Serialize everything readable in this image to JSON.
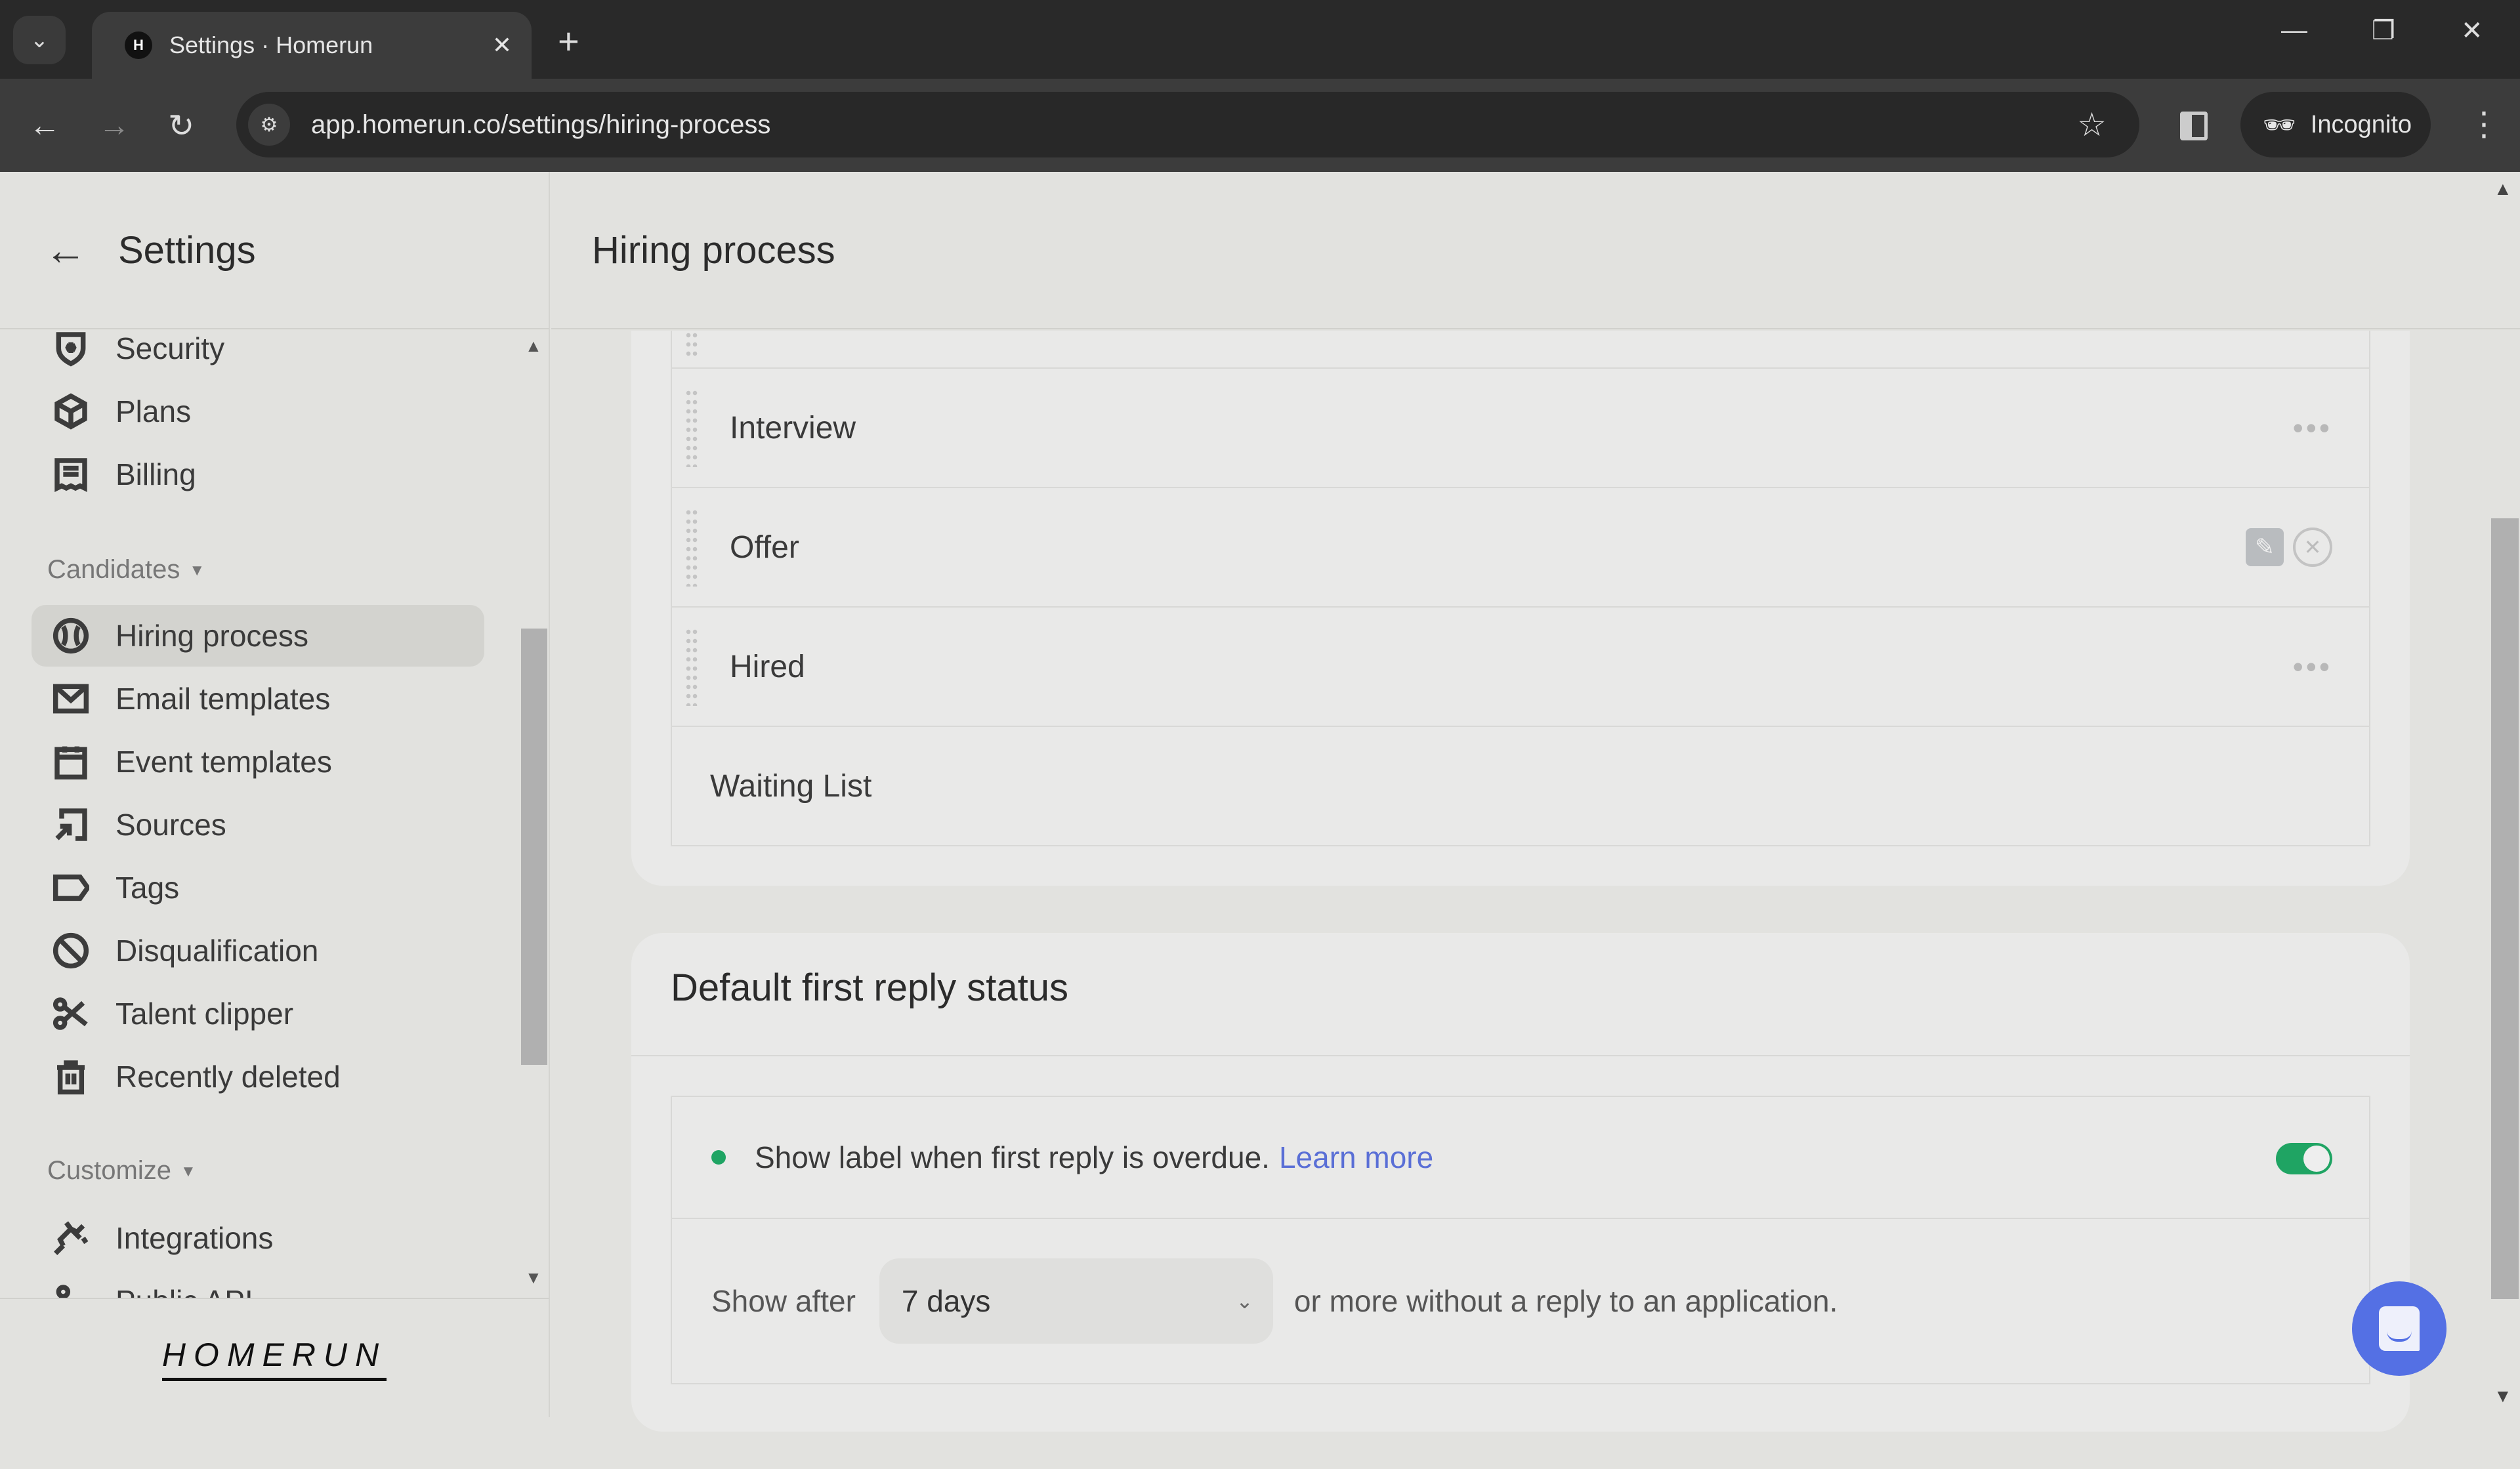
{
  "browser": {
    "tab_title": "Settings · Homerun",
    "url": "app.homerun.co/settings/hiring-process",
    "incognito_label": "Incognito"
  },
  "sidebar": {
    "title": "Settings",
    "items_top": [
      {
        "label": "Security",
        "icon": "shield-star-icon"
      },
      {
        "label": "Plans",
        "icon": "box-icon"
      },
      {
        "label": "Billing",
        "icon": "receipt-icon"
      }
    ],
    "sections": [
      {
        "label": "Candidates",
        "items": [
          {
            "label": "Hiring process",
            "icon": "baseball-icon",
            "active": true
          },
          {
            "label": "Email templates",
            "icon": "envelope-icon"
          },
          {
            "label": "Event templates",
            "icon": "calendar-icon"
          },
          {
            "label": "Sources",
            "icon": "sources-arrow-icon"
          },
          {
            "label": "Tags",
            "icon": "tag-icon"
          },
          {
            "label": "Disqualification",
            "icon": "ban-icon"
          },
          {
            "label": "Talent clipper",
            "icon": "scissors-icon"
          },
          {
            "label": "Recently deleted",
            "icon": "trash-icon"
          }
        ]
      },
      {
        "label": "Customize",
        "items": [
          {
            "label": "Integrations",
            "icon": "plug-icon"
          },
          {
            "label": "Public API",
            "icon": "api-icon"
          }
        ]
      }
    ],
    "logo": "HOMERUN"
  },
  "main": {
    "page_title": "Hiring process",
    "stages": [
      {
        "name": "Interview",
        "actions": "more"
      },
      {
        "name": "Offer",
        "actions": "edit-delete"
      },
      {
        "name": "Hired",
        "actions": "more"
      },
      {
        "name": "Waiting List",
        "actions": "none"
      }
    ],
    "first_reply": {
      "title": "Default first reply status",
      "toggle_text": "Show label when first reply is overdue.",
      "learn_more": "Learn more",
      "toggle_on": true,
      "show_after_label": "Show after",
      "selected_option": "7 days",
      "after_text": "or more without a reply to an application."
    }
  },
  "colors": {
    "accent_green": "#1fa463",
    "link_blue": "#5a6fd6",
    "chat_blue": "#5470e4"
  }
}
